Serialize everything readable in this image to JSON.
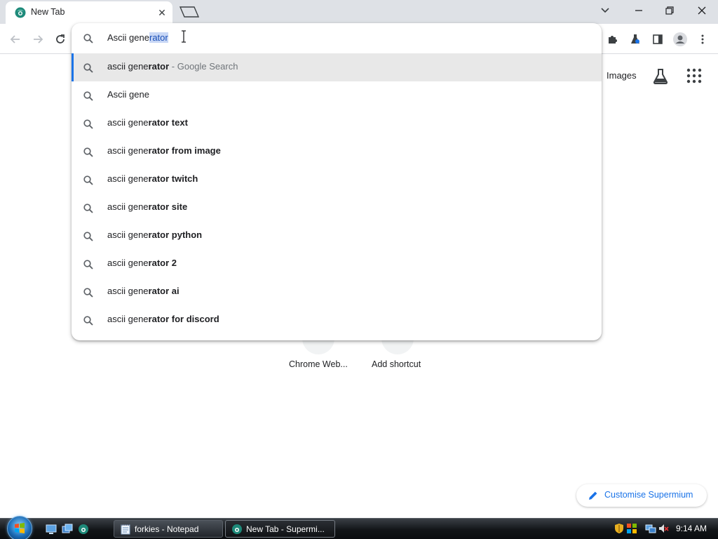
{
  "browser": {
    "tab": {
      "title": "New Tab",
      "close_glyph": "✕"
    },
    "window_controls": [
      "chevron-down-icon",
      "minimize-icon",
      "restore-icon",
      "close-icon"
    ]
  },
  "omnibox": {
    "typed_prefix": "Ascii gene",
    "selected_completion": "rator",
    "suggestions": [
      {
        "normal": "ascii gene",
        "bold": "rator",
        "suffix": " - Google Search",
        "selected": true
      },
      {
        "normal": "Ascii gene",
        "bold": "",
        "suffix": ""
      },
      {
        "normal": "ascii gene",
        "bold": "rator text",
        "suffix": ""
      },
      {
        "normal": "ascii gene",
        "bold": "rator from image",
        "suffix": ""
      },
      {
        "normal": "ascii gene",
        "bold": "rator twitch",
        "suffix": ""
      },
      {
        "normal": "ascii gene",
        "bold": "rator site",
        "suffix": ""
      },
      {
        "normal": "ascii gene",
        "bold": "rator python",
        "suffix": ""
      },
      {
        "normal": "ascii gene",
        "bold": "rator 2",
        "suffix": ""
      },
      {
        "normal": "ascii gene",
        "bold": "rator ai",
        "suffix": ""
      },
      {
        "normal": "ascii gene",
        "bold": "rator for discord",
        "suffix": ""
      }
    ]
  },
  "page": {
    "images_link": "Images",
    "shortcuts": [
      {
        "label": "Chrome Web..."
      },
      {
        "label": "Add shortcut"
      }
    ],
    "customise_label": "Customise Supermium"
  },
  "taskbar": {
    "buttons": [
      {
        "label": "forkies - Notepad"
      },
      {
        "label": "New Tab - Supermi..."
      }
    ],
    "clock": "9:14 AM"
  },
  "colors": {
    "accent": "#1a73e8",
    "selection_bg": "#c8d7f5",
    "selected_row_bg": "#e8e8e8",
    "tabstrip_bg": "#dee1e6"
  }
}
